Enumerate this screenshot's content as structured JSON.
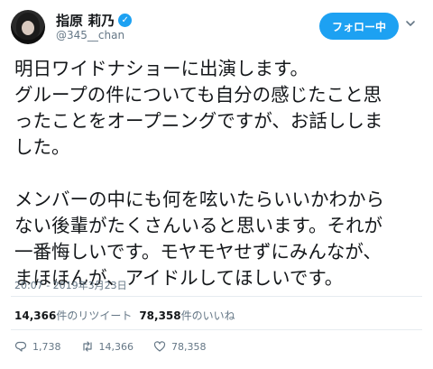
{
  "author": {
    "display_name": "指原 莉乃",
    "handle": "@345__chan",
    "verified_mark": "✓"
  },
  "follow_button_label": "フォロー中",
  "tweet_lines": [
    "明日ワイドナショーに出演します。",
    "グループの件についても自分の感じたこと思",
    "ったことをオープニングですが、お話ししま",
    "した。",
    "",
    "メンバーの中にも何を呟いたらいいかわから",
    "ない後輩がたくさんいると思います。それが",
    "一番悔しいです。モヤモヤせずにみんなが、",
    "まほほんが、アイドルしてほしいです。"
  ],
  "timestamp": "20:07 - 2019年3月23日",
  "stats": {
    "retweets_count": "14,366",
    "retweets_label": "件のリツイート",
    "likes_count": "78,358",
    "likes_label": "件のいいね"
  },
  "actions": {
    "reply_count": "1,738",
    "retweet_count": "14,366",
    "like_count": "78,358"
  },
  "colors": {
    "accent": "#1da1f2",
    "secondary_text": "#657786",
    "divider": "#e6ecf0"
  },
  "icons": [
    "verified-icon",
    "caret-down-icon",
    "reply-icon",
    "retweet-icon",
    "like-icon"
  ]
}
